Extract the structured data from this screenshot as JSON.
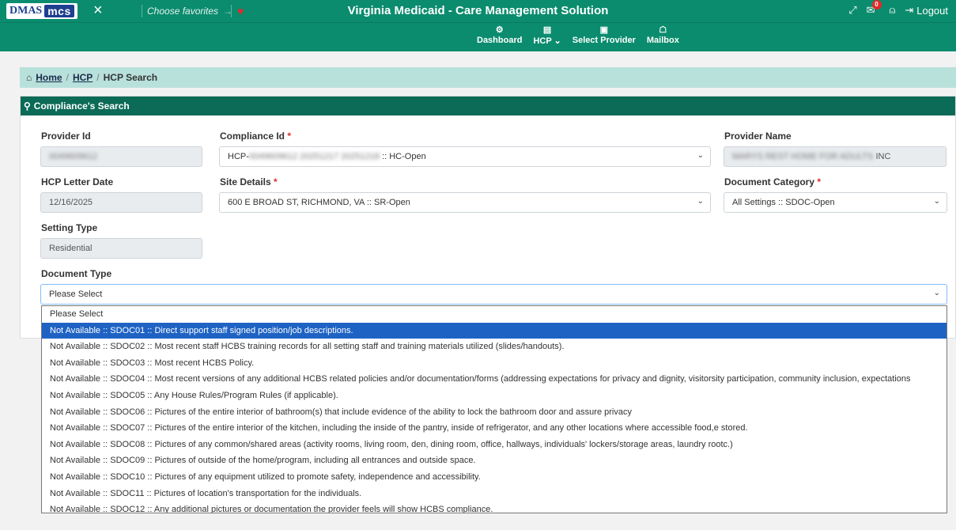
{
  "app": {
    "title": "Virginia Medicaid - Care Management Solution",
    "logo_left": "DMAS",
    "logo_right": "mcs",
    "favorites_placeholder": "Choose favorites",
    "mail_badge": "0",
    "logout_label": "Logout"
  },
  "nav": {
    "items": [
      {
        "icon": "dashboard-icon",
        "glyph": "⚙",
        "label": "Dashboard"
      },
      {
        "icon": "hcp-icon",
        "glyph": "▤",
        "label": "HCP ⌄"
      },
      {
        "icon": "briefcase-icon",
        "glyph": "▣",
        "label": "Select Provider"
      },
      {
        "icon": "mailbox-icon",
        "glyph": "☖",
        "label": "Mailbox"
      }
    ]
  },
  "breadcrumb": {
    "home": "Home",
    "hcp": "HCP",
    "current": "HCP Search"
  },
  "panel": {
    "title": "Compliance's Search"
  },
  "form": {
    "provider_id_label": "Provider Id",
    "provider_id_value": "0049609612",
    "compliance_id_label": "Compliance Id",
    "compliance_id_value_prefix": "HCP-",
    "compliance_id_value_hidden": "0049609612 20251217 20251218",
    "compliance_id_value_suffix": ":: HC-Open",
    "provider_name_label": "Provider Name",
    "provider_name_hidden": "MARYS REST HOME FOR ADULTS",
    "provider_name_suffix": "INC",
    "hcp_letter_date_label": "HCP Letter Date",
    "hcp_letter_date_value": "12/16/2025",
    "site_details_label": "Site Details",
    "site_details_value": "600 E BROAD ST, RICHMOND, VA :: SR-Open",
    "document_category_label": "Document Category",
    "document_category_value": "All Settings :: SDOC-Open",
    "setting_type_label": "Setting Type",
    "setting_type_value": "Residential",
    "document_type_label": "Document Type",
    "document_type_value": "Please Select",
    "required_mark": "*"
  },
  "document_type_options": [
    "Please Select",
    "Not Available :: SDOC01 :: Direct support staff signed position/job descriptions.",
    "Not Available :: SDOC02 :: Most recent staff HCBS training records for all setting staff and training materials utilized (slides/handouts).",
    "Not Available :: SDOC03 :: Most recent HCBS Policy.",
    "Not Available :: SDOC04 :: Most recent versions of any additional HCBS related policies and/or documentation/forms (addressing expectations for privacy and dignity, visitorsity participation, community inclusion, expectations",
    "Not Available :: SDOC05 :: Any House Rules/Program Rules (if applicable).",
    "Not Available :: SDOC06 :: Pictures of the entire interior of bathroom(s) that include evidence of the ability to lock the bathroom door and assure privacy",
    "Not Available :: SDOC07 :: Pictures of the entire interior of the kitchen, including the inside of the pantry, inside of refrigerator, and any other locations where accessible food,e stored.",
    "Not Available :: SDOC08 :: Pictures of any common/shared areas (activity rooms, living room, den, dining room, office, hallways, individuals' lockers/storage areas, laundry rootc.)",
    "Not Available :: SDOC09 :: Pictures of outside of the home/program, including all entrances and outside space.",
    "Not Available :: SDOC10 :: Pictures of any equipment utilized to promote safety, independence and accessibility.",
    "Not Available :: SDOC11 :: Pictures of location's transportation for the individuals.",
    "Not Available :: SDOC12 :: Any additional pictures or documentation the provider feels will show HCBS compliance."
  ],
  "active_option_index": 1,
  "colors": {
    "primary": "#0b8c6e",
    "panel_header": "#0b6b57",
    "breadcrumb_bg": "#b9e1dc",
    "highlight": "#1e63c4",
    "required": "#e02a2a"
  }
}
